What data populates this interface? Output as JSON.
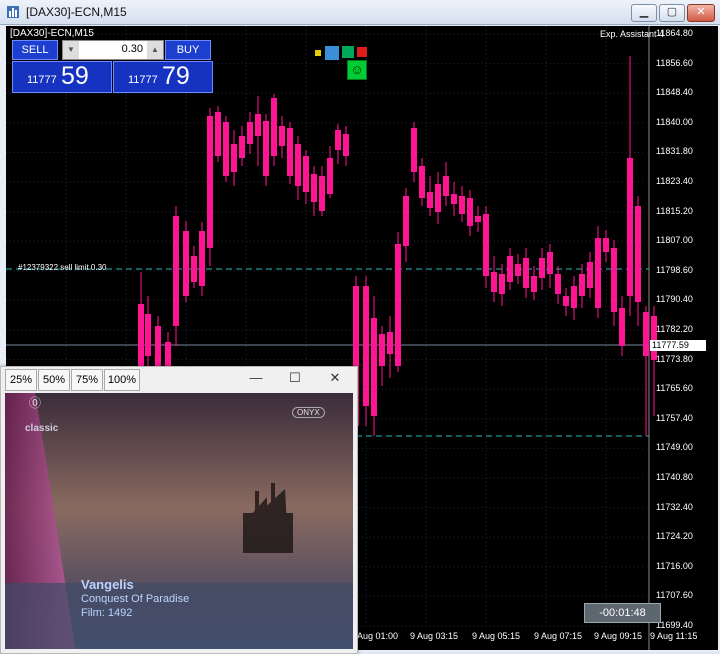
{
  "window": {
    "title": "[DAX30]-ECN,M15"
  },
  "chart": {
    "symbol_label": "[DAX30]-ECN,M15",
    "ea_label": "Exp. Assistant 4",
    "sell_label": "SELL",
    "buy_label": "BUY",
    "lot_value": "0.30",
    "sell_price_small": "11777",
    "sell_price_big": "59",
    "buy_price_small": "11777",
    "buy_price_big": "79",
    "current_price": "11777.59",
    "pending_order_label": "#12379322 sell limit 0.30",
    "timer": "-00:01:48",
    "y_axis_labels": [
      "11864.80",
      "11856.60",
      "11848.40",
      "11840.00",
      "11831.80",
      "11823.40",
      "11815.20",
      "11807.00",
      "11798.60",
      "11790.40",
      "11782.20",
      "11773.80",
      "11765.60",
      "11757.40",
      "11749.00",
      "11740.80",
      "11732.40",
      "11724.20",
      "11716.00",
      "11707.60",
      "11699.40"
    ],
    "x_axis_labels": [
      "9 Aug 01:00",
      "9 Aug 03:15",
      "9 Aug 05:15",
      "9 Aug 07:15",
      "9 Aug 09:15",
      "9 Aug 11:15"
    ],
    "colors": {
      "bull": "#00ff00",
      "bear": "#ff1493",
      "grid": "#1e2a3a",
      "dash_line": "#2ab7b7",
      "price_line": "#7a8aa0"
    }
  },
  "player": {
    "zoom_options": [
      "25%",
      "50%",
      "75%",
      "100%"
    ],
    "minimize_icon": "minimize-icon",
    "maximize_icon": "maximize-icon",
    "close_icon": "close-icon",
    "channel_logo": "classic",
    "channel_logo_right": "ONYX",
    "artist": "Vangelis",
    "song": "Conquest Of Paradise",
    "film": "Film: 1492"
  }
}
